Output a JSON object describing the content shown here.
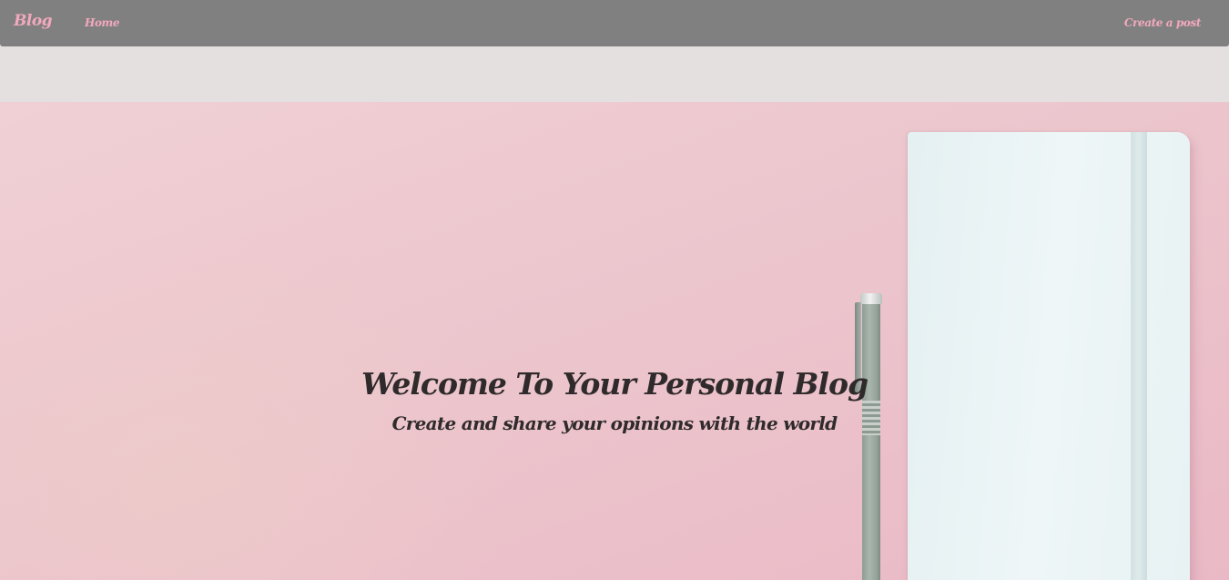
{
  "navbar": {
    "brand": "Blog",
    "links": {
      "home": "Home",
      "create_post": "Create a post"
    }
  },
  "hero": {
    "title": "Welcome To Your Personal Blog",
    "subtitle": "Create and share your opinions with the world"
  },
  "colors": {
    "navbar_bg": "#808080",
    "nav_accent": "#f2a9bd",
    "hero_bg": "#eec7ce",
    "hero_text": "#2f2a2b"
  }
}
